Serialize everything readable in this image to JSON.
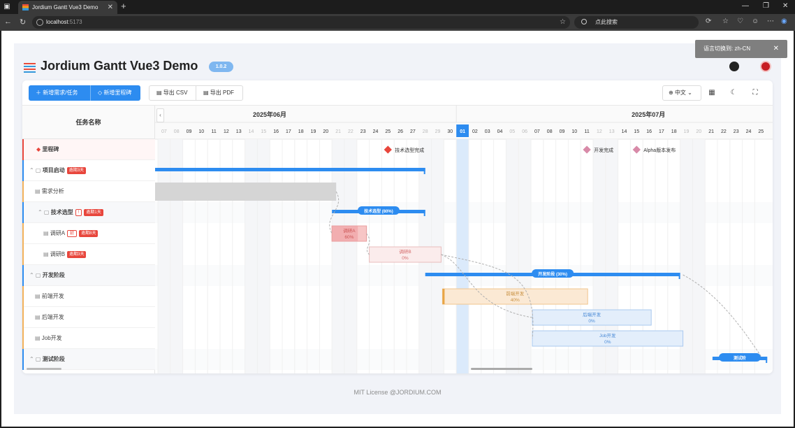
{
  "browser": {
    "tab_title": "Jordium Gantt Vue3 Demo",
    "url_host": "localhost",
    "url_port": ":5173",
    "search_placeholder": "点此搜索"
  },
  "app": {
    "title": "Jordium Gantt Vue3 Demo",
    "version": "1.0.2",
    "toast": "语言切换到: zh-CN",
    "footer": "MIT License @JORDIUM.COM"
  },
  "toolbar": {
    "add_task": "新增需求/任务",
    "add_milestone": "新增里程碑",
    "export_csv": "导出 CSV",
    "export_pdf": "导出 PDF",
    "language": "中文"
  },
  "tasklist": {
    "header": "任务名称",
    "rows": [
      {
        "name": "里程碑",
        "badge": "",
        "badge2": "",
        "color": "#e8463c"
      },
      {
        "name": "项目启动",
        "badge": "逾期3天",
        "badge2": "",
        "color": "#2d8cf0"
      },
      {
        "name": "需求分析",
        "badge": "",
        "badge2": "",
        "color": "#f2b25c"
      },
      {
        "name": "技术选型",
        "badge": "逾期1天",
        "badge2": "!",
        "color": "#2d8cf0"
      },
      {
        "name": "调研A",
        "badge": "逾期8天",
        "badge2": "延",
        "color": "#f2b25c"
      },
      {
        "name": "调研B",
        "badge": "逾期3天",
        "badge2": "",
        "color": "#f2b25c"
      },
      {
        "name": "开发阶段",
        "badge": "",
        "badge2": "",
        "color": "#2d8cf0"
      },
      {
        "name": "前端开发",
        "badge": "",
        "badge2": "",
        "color": "#f2b25c"
      },
      {
        "name": "后端开发",
        "badge": "",
        "badge2": "",
        "color": "#f2b25c"
      },
      {
        "name": "Job开发",
        "badge": "",
        "badge2": "",
        "color": "#f2b25c"
      },
      {
        "name": "测试阶段",
        "badge": "",
        "badge2": "",
        "color": "#2d8cf0"
      }
    ]
  },
  "timeline": {
    "months": [
      "2025年06月",
      "2025年07月"
    ],
    "days_june": [
      "07",
      "08",
      "09",
      "10",
      "11",
      "12",
      "13",
      "14",
      "15",
      "16",
      "17",
      "18",
      "19",
      "20",
      "21",
      "22",
      "23",
      "24",
      "25",
      "26",
      "27",
      "28",
      "29",
      "30"
    ],
    "days_july": [
      "01",
      "02",
      "03",
      "04",
      "05",
      "06",
      "07",
      "08",
      "09",
      "10",
      "11",
      "12",
      "13",
      "14",
      "15",
      "16",
      "17",
      "18",
      "19",
      "20",
      "21",
      "22",
      "23",
      "24",
      "25"
    ],
    "today": "01",
    "milestones": [
      {
        "label": "技术选型完成"
      },
      {
        "label": "开发完成"
      },
      {
        "label": "Alpha版本发布"
      }
    ],
    "bars": [
      {
        "label": "技术选型 (80%)"
      },
      {
        "label": "调研A",
        "progress": "60%"
      },
      {
        "label": "调研B",
        "progress": "0%"
      },
      {
        "label": "开发阶段 (30%)"
      },
      {
        "label": "前端开发",
        "progress": "40%"
      },
      {
        "label": "后端开发",
        "progress": "0%"
      },
      {
        "label": "Job开发",
        "progress": "0%"
      },
      {
        "label": "测试阶"
      }
    ]
  }
}
